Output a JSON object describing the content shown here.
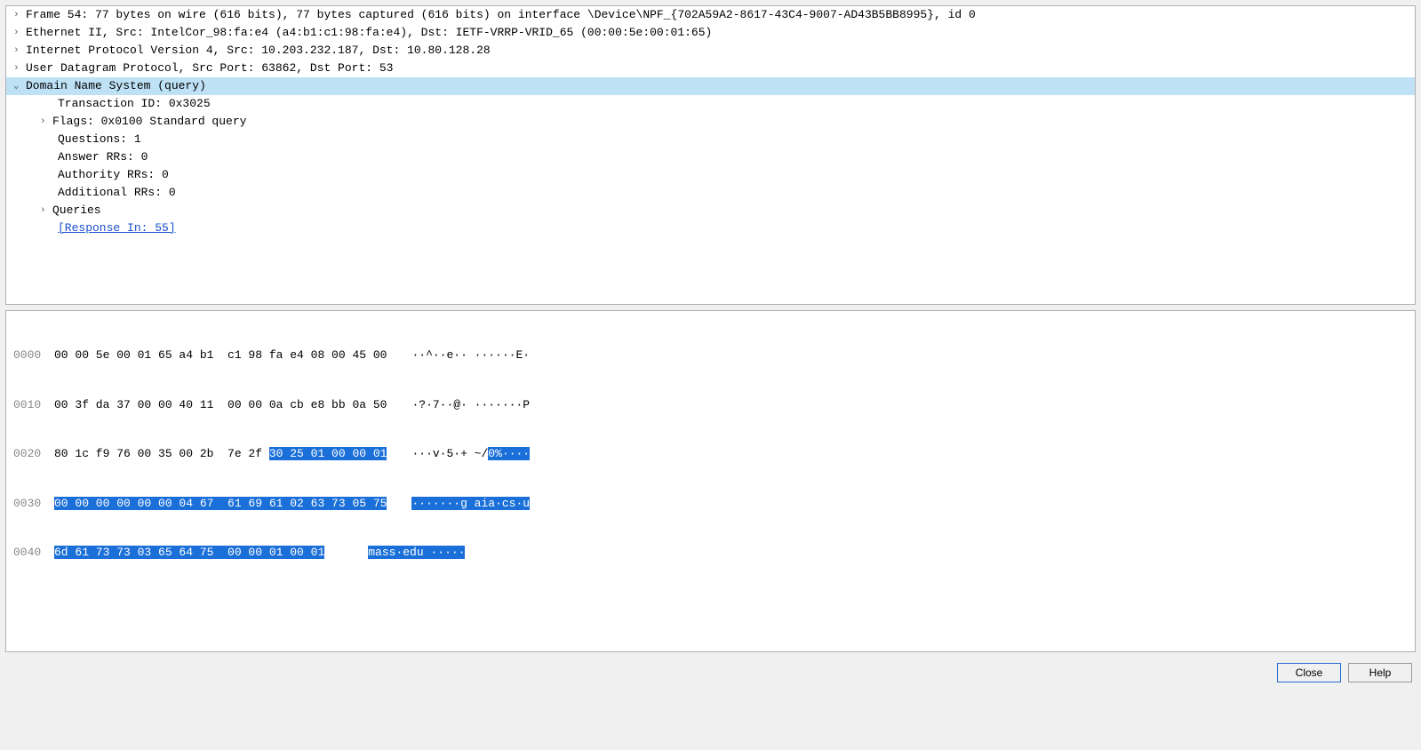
{
  "tree": {
    "frame": "Frame 54: 77 bytes on wire (616 bits), 77 bytes captured (616 bits) on interface \\Device\\NPF_{702A59A2-8617-43C4-9007-AD43B5BB8995}, id 0",
    "ethernet": "Ethernet II, Src: IntelCor_98:fa:e4 (a4:b1:c1:98:fa:e4), Dst: IETF-VRRP-VRID_65 (00:00:5e:00:01:65)",
    "ip": "Internet Protocol Version 4, Src: 10.203.232.187, Dst: 10.80.128.28",
    "udp": "User Datagram Protocol, Src Port: 63862, Dst Port: 53",
    "dns": "Domain Name System (query)",
    "transaction": "Transaction ID: 0x3025",
    "flags": "Flags: 0x0100 Standard query",
    "questions": "Questions: 1",
    "answer": "Answer RRs: 0",
    "authority": "Authority RRs: 0",
    "additional": "Additional RRs: 0",
    "queries": "Queries",
    "response": "[Response In: 55]"
  },
  "hex": {
    "l0": {
      "off": "0000",
      "b": "00 00 5e 00 01 65 a4 b1  c1 98 fa e4 08 00 45 00",
      "a": "··^··e·· ······E·"
    },
    "l1": {
      "off": "0010",
      "b": "00 3f da 37 00 00 40 11  00 00 0a cb e8 bb 0a 50",
      "a": "·?·7··@· ·······P"
    },
    "l2": {
      "off": "0020",
      "b1": "80 1c f9 76 00 35 00 2b  7e 2f ",
      "b2": "30 25 01 00 00 01",
      "a1": "···v·5·+ ~/",
      "a2": "0%····"
    },
    "l3": {
      "off": "0030",
      "b": "00 00 00 00 00 00 04 67  61 69 61 02 63 73 05 75",
      "a1": "·······g aia·cs·u"
    },
    "l4": {
      "off": "0040",
      "b1": "6d 61 73 73 03 65 64 75  00 00 01 00 01",
      "a1": "mass·edu ·····"
    }
  },
  "buttons": {
    "close": "Close",
    "help": "Help"
  }
}
